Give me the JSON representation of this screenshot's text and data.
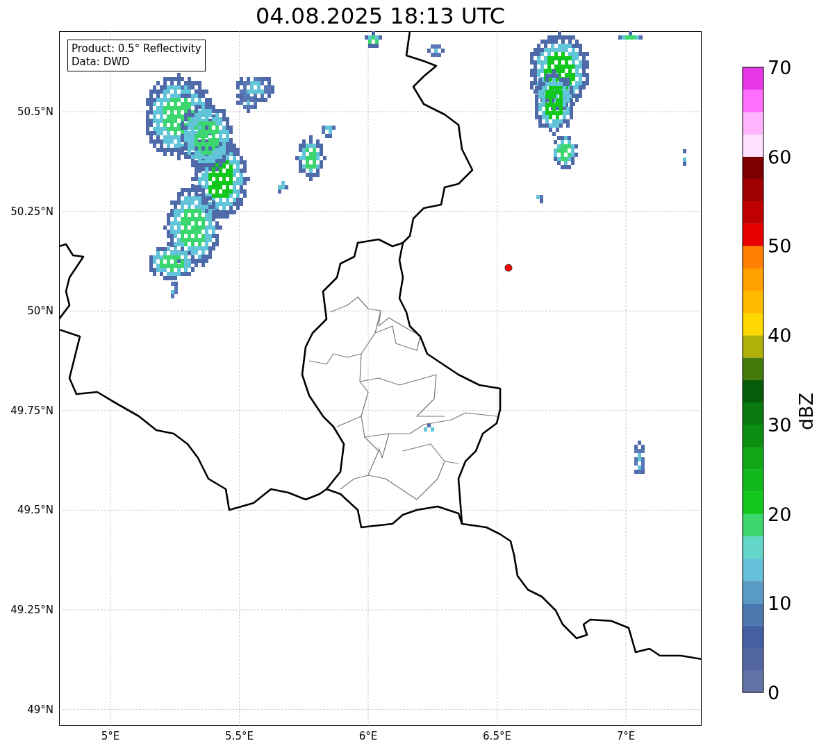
{
  "title": "04.08.2025 18:13 UTC",
  "info": [
    "Product: 0.5° Reflectivity",
    "Data: DWD"
  ],
  "x_ticks": [
    "5°E",
    "5.5°E",
    "6°E",
    "6.5°E",
    "7°E"
  ],
  "y_ticks": [
    "50.5°N",
    "50.25°N",
    "50°N",
    "49.75°N",
    "49.5°N",
    "49.25°N",
    "49°N"
  ],
  "colorbar": {
    "label": "dBZ",
    "ticks": [
      "70",
      "60",
      "50",
      "40",
      "30",
      "20",
      "10",
      "0"
    ],
    "segments": [
      {
        "color": "#6272a6"
      },
      {
        "color": "#52679f"
      },
      {
        "color": "#4460a3"
      },
      {
        "color": "#4b79b0"
      },
      {
        "color": "#5b9cc5"
      },
      {
        "color": "#67c1dc"
      },
      {
        "color": "#64d7c8"
      },
      {
        "color": "#3cd66e"
      },
      {
        "color": "#12c81c"
      },
      {
        "color": "#10b81a"
      },
      {
        "color": "#0fa714"
      },
      {
        "color": "#0c8e12"
      },
      {
        "color": "#0a7a10"
      },
      {
        "color": "#075c0c"
      },
      {
        "color": "#447a0c"
      },
      {
        "color": "#b0b00a"
      },
      {
        "color": "#ffd700"
      },
      {
        "color": "#ffb900"
      },
      {
        "color": "#ff9f00"
      },
      {
        "color": "#ff7f00"
      },
      {
        "color": "#e60000"
      },
      {
        "color": "#c00000"
      },
      {
        "color": "#a00000"
      },
      {
        "color": "#7d0000"
      },
      {
        "color": "#ffe0ff"
      },
      {
        "color": "#ffb5ff"
      },
      {
        "color": "#ff6eff"
      },
      {
        "color": "#e838e8"
      }
    ]
  }
}
